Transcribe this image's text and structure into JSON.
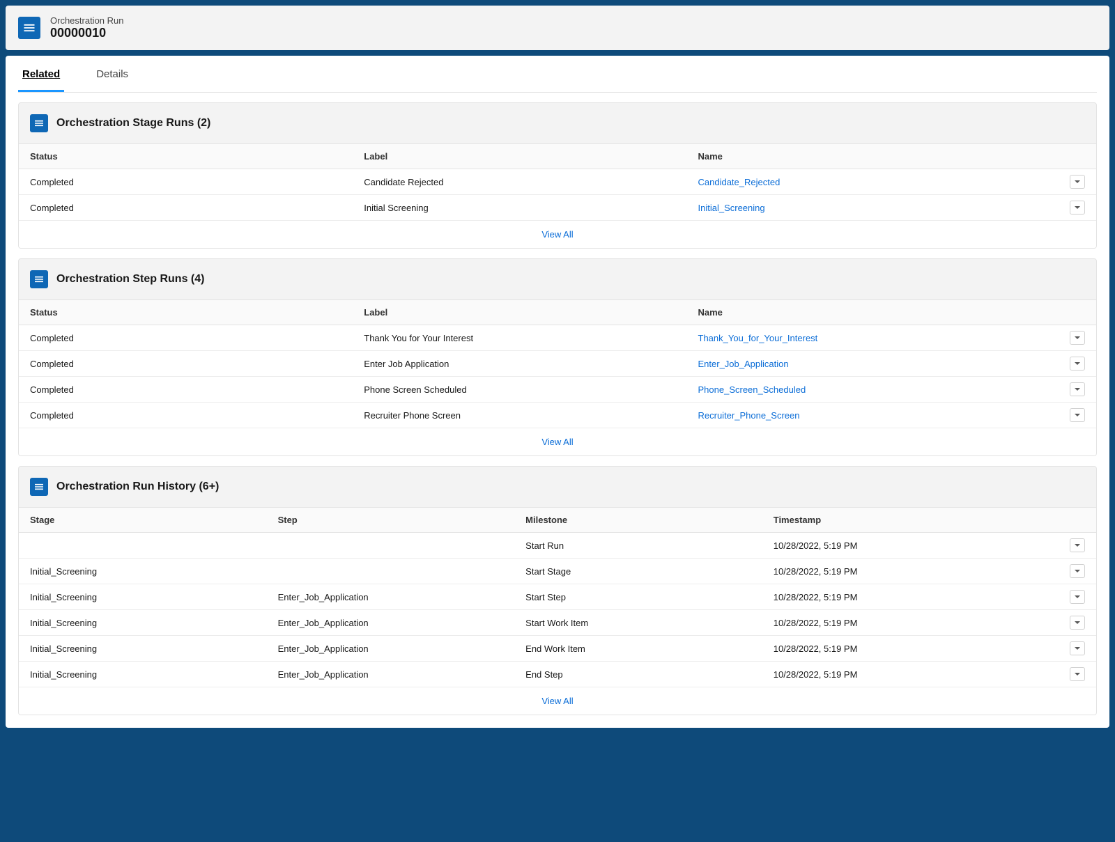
{
  "header": {
    "subtitle": "Orchestration Run",
    "title": "00000010"
  },
  "tabs": {
    "related": "Related",
    "details": "Details"
  },
  "section1": {
    "title": "Orchestration Stage Runs (2)",
    "cols": {
      "status": "Status",
      "label": "Label",
      "name": "Name"
    },
    "rows": [
      {
        "status": "Completed",
        "label": "Candidate Rejected",
        "name": "Candidate_Rejected"
      },
      {
        "status": "Completed",
        "label": "Initial Screening",
        "name": "Initial_Screening"
      }
    ],
    "viewAll": "View All"
  },
  "section2": {
    "title": "Orchestration Step Runs (4)",
    "cols": {
      "status": "Status",
      "label": "Label",
      "name": "Name"
    },
    "rows": [
      {
        "status": "Completed",
        "label": "Thank You for Your Interest",
        "name": "Thank_You_for_Your_Interest"
      },
      {
        "status": "Completed",
        "label": "Enter Job Application",
        "name": "Enter_Job_Application"
      },
      {
        "status": "Completed",
        "label": "Phone Screen Scheduled",
        "name": "Phone_Screen_Scheduled"
      },
      {
        "status": "Completed",
        "label": "Recruiter Phone Screen",
        "name": "Recruiter_Phone_Screen"
      }
    ],
    "viewAll": "View All"
  },
  "section3": {
    "title": "Orchestration Run History (6+)",
    "cols": {
      "stage": "Stage",
      "step": "Step",
      "milestone": "Milestone",
      "timestamp": "Timestamp"
    },
    "rows": [
      {
        "stage": "",
        "step": "",
        "milestone": "Start Run",
        "timestamp": "10/28/2022, 5:19 PM"
      },
      {
        "stage": "Initial_Screening",
        "step": "",
        "milestone": "Start Stage",
        "timestamp": "10/28/2022, 5:19 PM"
      },
      {
        "stage": "Initial_Screening",
        "step": "Enter_Job_Application",
        "milestone": "Start Step",
        "timestamp": "10/28/2022, 5:19 PM"
      },
      {
        "stage": "Initial_Screening",
        "step": "Enter_Job_Application",
        "milestone": "Start Work Item",
        "timestamp": "10/28/2022, 5:19 PM"
      },
      {
        "stage": "Initial_Screening",
        "step": "Enter_Job_Application",
        "milestone": "End Work Item",
        "timestamp": "10/28/2022, 5:19 PM"
      },
      {
        "stage": "Initial_Screening",
        "step": "Enter_Job_Application",
        "milestone": "End Step",
        "timestamp": "10/28/2022, 5:19 PM"
      }
    ],
    "viewAll": "View All"
  }
}
